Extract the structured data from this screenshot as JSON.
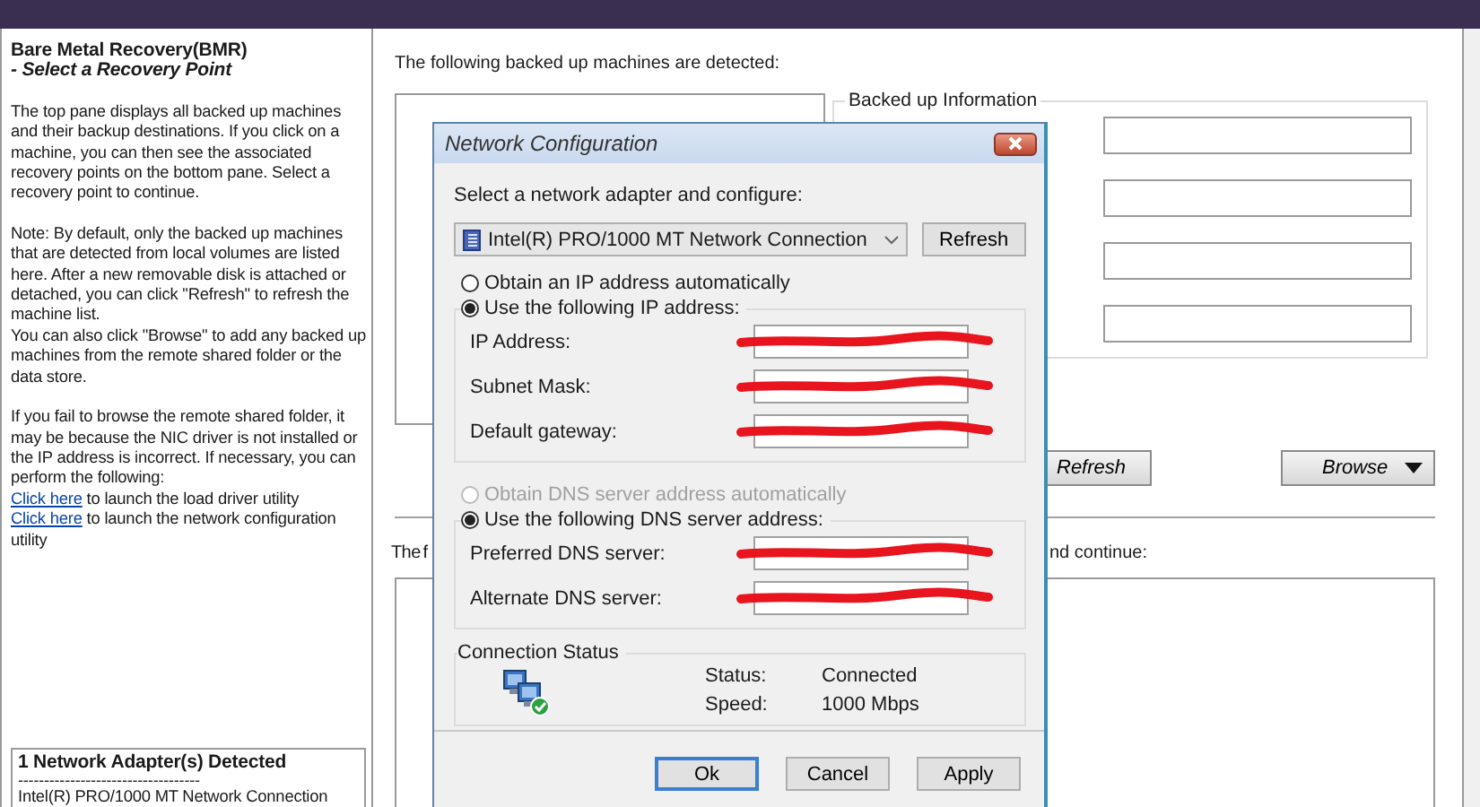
{
  "sidebar": {
    "title": "Bare Metal Recovery(BMR)",
    "subtitle": " - Select a Recovery Point",
    "sections": [
      [
        {
          "kind": "text",
          "text": "The top pane displays all backed up machines and their backup destinations. If you click on a machine, you can then see the associated recovery points on the bottom pane. Select a recovery point to continue."
        }
      ],
      [
        {
          "kind": "text",
          "text": "Note: By default, only the backed up machines that are detected from local volumes are listed here. After a new removable disk is attached or detached, you can click \"Refresh\" to refresh the machine list."
        },
        {
          "kind": "text",
          "text": "You can also click \"Browse\" to add any backed up machines from the remote shared folder or the data store."
        }
      ],
      [
        {
          "kind": "text",
          "text": "If you fail to browse the remote shared folder, it may be because the NIC driver is not installed or the IP address is incorrect. If necessary, you can perform the following:"
        },
        {
          "kind": "link",
          "link": "Click here",
          "text": " to launch the load driver utility"
        },
        {
          "kind": "link",
          "link": "Click here",
          "text": " to launch the network configuration utility"
        }
      ]
    ],
    "adapters_box": {
      "heading": "1 Network Adapter(s) Detected",
      "divider": "-----------------------------------",
      "adapter": "Intel(R) PRO/1000 MT Network Connection"
    }
  },
  "main": {
    "detected_label": "The following backed up machines are detected:",
    "info_group": {
      "legend": "Backed up Information",
      "fields": [
        {
          "kind": "empty"
        },
        {
          "kind": "empty"
        },
        {
          "kind": "empty"
        },
        {
          "kind": "empty"
        }
      ]
    },
    "buttons": [
      {
        "label": "Refresh",
        "dropdown": false
      },
      {
        "label": "Browse",
        "dropdown": true
      }
    ],
    "lower_label_parts": [
      "The f",
      "nd continue:"
    ]
  },
  "dialog": {
    "title": "Network Configuration",
    "prompt": "Select a network adapter and configure:",
    "adapter_select": {
      "value": "Intel(R) PRO/1000 MT Network Connection"
    },
    "refresh": "Refresh",
    "ip_options": [
      {
        "label": "Obtain an IP address automatically",
        "selected": false,
        "disabled": false
      },
      {
        "label": "Use the following IP address:",
        "selected": true,
        "disabled": false
      }
    ],
    "ip_fields": [
      {
        "label": "IP Address:",
        "redacted": true
      },
      {
        "label": "Subnet Mask:",
        "redacted": true
      },
      {
        "label": "Default gateway:",
        "redacted": true
      }
    ],
    "dns_options": [
      {
        "label": "Obtain DNS server address automatically",
        "selected": false,
        "disabled": true
      },
      {
        "label": "Use the following DNS server address:",
        "selected": true,
        "disabled": false
      }
    ],
    "dns_fields": [
      {
        "label": "Preferred DNS server:",
        "redacted": true
      },
      {
        "label": "Alternate DNS server:",
        "redacted": true
      }
    ],
    "connection_status": {
      "legend": "Connection Status",
      "rows": [
        {
          "label": "Status:",
          "value": "Connected"
        },
        {
          "label": "Speed:",
          "value": "1000 Mbps"
        }
      ]
    },
    "buttons": [
      {
        "label": "Ok",
        "focused": true
      },
      {
        "label": "Cancel",
        "focused": false
      },
      {
        "label": "Apply",
        "focused": false
      }
    ]
  }
}
